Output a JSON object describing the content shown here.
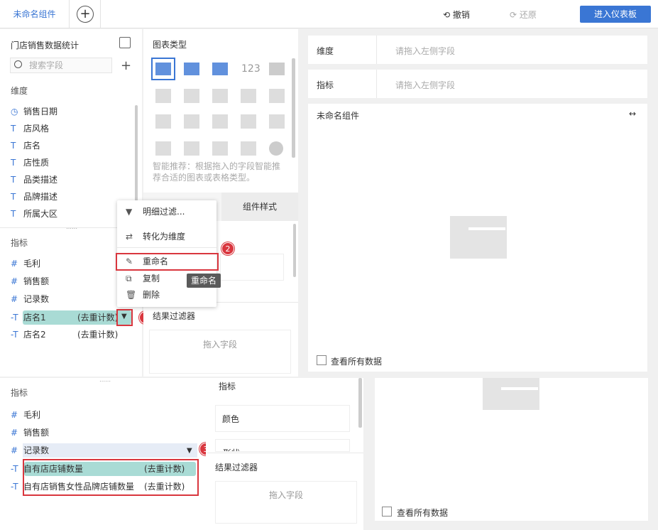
{
  "top": {
    "tab": "未命名组件",
    "add": "+",
    "undo": "撤销",
    "redo": "还原",
    "enter": "进入仪表板"
  },
  "left": {
    "title": "门店销售数据统计",
    "search_placeholder": "搜索字段",
    "dim_title": "维度",
    "dims": [
      "销售日期",
      "店风格",
      "店名",
      "店性质",
      "品类描述",
      "品牌描述",
      "所属大区"
    ],
    "metric_title": "指标",
    "metrics": [
      "毛利",
      "销售额",
      "记录数"
    ],
    "calc": [
      {
        "name": "店名1",
        "suffix": "(去重计数)"
      },
      {
        "name": "店名2",
        "suffix": "(去重计数)"
      }
    ]
  },
  "mid": {
    "chart_type_title": "图表类型",
    "hint": "智能推荐：根据拖入的字段智能推荐合适的图表或表格类型。",
    "tab_style": "组件样式",
    "filter_title": "结果过滤器",
    "drag_field": "拖入字段"
  },
  "menu": {
    "items": [
      "明细过滤...",
      "转化为维度",
      "重命名",
      "复制",
      "删除"
    ],
    "tooltip": "重命名"
  },
  "right": {
    "dim_label": "维度",
    "metric_label": "指标",
    "placeholder": "请拖入左侧字段",
    "comp_title": "未命名组件",
    "view_all": "查看所有数据"
  },
  "bottom": {
    "metric_title": "指标",
    "metrics": [
      "毛利",
      "销售额",
      "记录数"
    ],
    "calc": [
      {
        "name": "自有店店铺数量",
        "suffix": "(去重计数)"
      },
      {
        "name": "自有店销售女性品牌店铺数量",
        "suffix": "(去重计数)"
      }
    ],
    "mid_metric": "指标",
    "color": "颜色",
    "shape": "形状",
    "filter_title": "结果过滤器",
    "drag_field": "拖入字段",
    "view_all": "查看所有数据"
  },
  "badges": [
    "1",
    "2",
    "3"
  ]
}
